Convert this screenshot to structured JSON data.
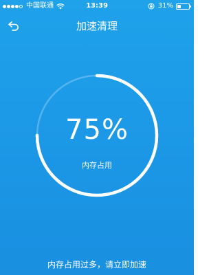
{
  "status_bar": {
    "carrier": "中国联通",
    "time": "13:39",
    "battery_percent": "31%",
    "battery_level": 0.31,
    "signal_bars_filled": 4,
    "signal_bars_total": 5
  },
  "header": {
    "title": "加速清理",
    "back_icon": "back-arrow-icon"
  },
  "gauge": {
    "percent_text": "75%",
    "label": "内存占用",
    "value": 0.75,
    "ring_color": "#ffffff",
    "track_color": "rgba(255,255,255,0.25)"
  },
  "footer": {
    "tip": "内存占用过多，请立即加速"
  },
  "colors": {
    "background": "#1b97e6",
    "foreground": "#ffffff"
  }
}
